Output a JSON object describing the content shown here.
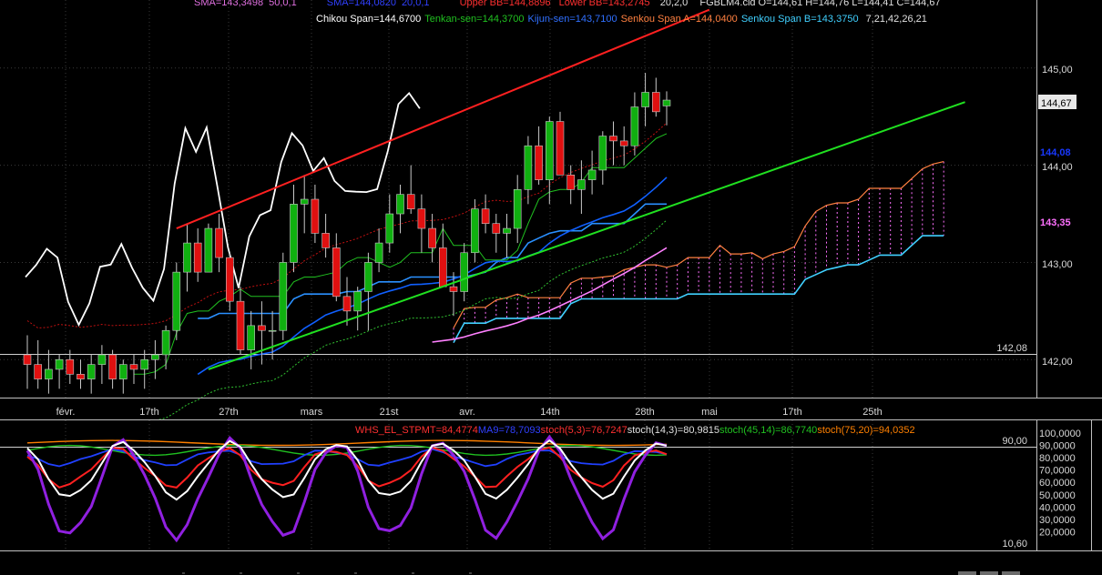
{
  "instrument": {
    "ohlc_label": "FGBLM4.cld O=144,61 H=144,76 L=144,41 C=144,67",
    "sma1_label": "SMA=143,3498",
    "sma1_params": "50,0,1",
    "sma2_label": "SMA=144,0820",
    "sma2_params": "20,0,1",
    "upper_bb_label": "Upper BB=144,8896",
    "lower_bb_label": "Lower BB=143,2745",
    "bb_params": "20,2,0"
  },
  "ichimoku": {
    "chikou": "Chikou Span=144,6700",
    "tenkan": "Tenkan-sen=144,3700",
    "kijun": "Kijun-sen=143,7100",
    "senkou_a": "Senkou Span A=144,0400",
    "senkou_b": "Senkou Span B=143,3750",
    "params": "7,21,42,26,21"
  },
  "price_axis": {
    "ticks": [
      "145,00",
      "144,00",
      "143,00",
      "142,00"
    ],
    "last_price": "144,67",
    "sma20_value": "144,08",
    "sma50_value": "143,35",
    "support_level": "142,08"
  },
  "indicator": {
    "whs": "WHS_EL_STPMT=84,4774",
    "ma9": "MA9=78,7093",
    "stoch1": "stoch(5,3)=76,7247",
    "stoch2": "stoch(14,3)=80,9815",
    "stoch3": "stoch(45,14)=86,7740",
    "stoch4": "stoch(75,20)=94,0352",
    "ticks": [
      "100,0000",
      "90,0000",
      "80,0000",
      "70,0000",
      "60,0000",
      "50,0000",
      "40,0000",
      "30,0000",
      "20,0000"
    ],
    "level_high": "90,00",
    "level_low": "10,60"
  },
  "x_axis_labels": [
    "févr.",
    "17th",
    "27th",
    "mars",
    "21st",
    "avr.",
    "14th",
    "28th",
    "mai",
    "17th",
    "25th"
  ],
  "colors": {
    "background": "#000000",
    "bull_candle": "#10b010",
    "bear_candle": "#e01010",
    "chikou": "#ffffff",
    "tenkan": "#20c020",
    "kijun": "#1060ff",
    "senkou_a": "#ff8040",
    "senkou_b": "#40d0ff",
    "sma50": "#ff80ff",
    "upper_trend": "#ff2020",
    "lower_trend": "#20e020",
    "whs": "#ff2020",
    "ma9": "#2040ff",
    "stoch_5_3": "#ffffff",
    "stoch_14_3": "#9020e0",
    "stoch_45_14": "#20c020",
    "stoch_75_20": "#ff8000"
  },
  "chart_data": {
    "type": "candlestick",
    "symbol": "FGBLM4",
    "ohlc_last": {
      "open": 144.61,
      "high": 144.76,
      "low": 144.41,
      "close": 144.67
    },
    "y_range": [
      141.6,
      145.7
    ],
    "candles": [
      [
        142.05,
        142.25,
        141.7,
        141.95
      ],
      [
        141.95,
        142.2,
        141.7,
        141.8
      ],
      [
        141.8,
        142.1,
        141.65,
        141.9
      ],
      [
        141.9,
        142.05,
        141.7,
        142.0
      ],
      [
        142.0,
        142.1,
        141.75,
        141.85
      ],
      [
        141.85,
        142.0,
        141.7,
        141.8
      ],
      [
        141.8,
        142.05,
        141.65,
        141.95
      ],
      [
        141.95,
        142.15,
        141.75,
        142.05
      ],
      [
        142.05,
        142.1,
        141.7,
        141.8
      ],
      [
        141.8,
        142.0,
        141.65,
        141.95
      ],
      [
        141.95,
        142.05,
        141.75,
        141.9
      ],
      [
        141.9,
        142.1,
        141.7,
        142.0
      ],
      [
        142.0,
        142.2,
        141.8,
        142.05
      ],
      [
        142.05,
        142.35,
        141.9,
        142.3
      ],
      [
        142.3,
        143.0,
        142.2,
        142.9
      ],
      [
        142.9,
        143.4,
        142.7,
        143.2
      ],
      [
        143.2,
        143.35,
        142.8,
        142.9
      ],
      [
        142.9,
        143.4,
        142.9,
        143.35
      ],
      [
        143.35,
        143.5,
        142.9,
        143.05
      ],
      [
        143.05,
        143.1,
        142.5,
        142.6
      ],
      [
        142.6,
        142.75,
        142.05,
        142.1
      ],
      [
        142.1,
        142.5,
        141.9,
        142.35
      ],
      [
        142.35,
        142.6,
        141.95,
        142.3
      ],
      [
        142.3,
        142.5,
        142.0,
        142.3
      ],
      [
        142.3,
        143.1,
        142.2,
        143.0
      ],
      [
        143.0,
        143.8,
        142.9,
        143.6
      ],
      [
        143.6,
        143.9,
        143.3,
        143.65
      ],
      [
        143.65,
        143.8,
        143.2,
        143.3
      ],
      [
        143.3,
        143.5,
        143.05,
        143.15
      ],
      [
        143.15,
        143.3,
        142.6,
        142.65
      ],
      [
        142.65,
        142.85,
        142.35,
        142.5
      ],
      [
        142.5,
        142.75,
        142.3,
        142.7
      ],
      [
        142.7,
        143.1,
        142.3,
        143.0
      ],
      [
        143.0,
        143.35,
        142.9,
        143.2
      ],
      [
        143.2,
        143.7,
        143.1,
        143.5
      ],
      [
        143.5,
        143.8,
        143.3,
        143.7
      ],
      [
        143.7,
        144.0,
        143.5,
        143.55
      ],
      [
        143.55,
        143.7,
        143.1,
        143.35
      ],
      [
        143.35,
        143.5,
        143.0,
        143.15
      ],
      [
        143.15,
        143.4,
        142.8,
        142.75
      ],
      [
        142.75,
        142.9,
        142.45,
        142.7
      ],
      [
        142.7,
        143.2,
        142.6,
        143.1
      ],
      [
        143.1,
        143.65,
        143.0,
        143.55
      ],
      [
        143.55,
        143.7,
        143.3,
        143.4
      ],
      [
        143.4,
        143.5,
        143.1,
        143.3
      ],
      [
        143.3,
        143.5,
        143.05,
        143.35
      ],
      [
        143.35,
        143.9,
        143.2,
        143.75
      ],
      [
        143.75,
        144.3,
        143.6,
        144.2
      ],
      [
        144.2,
        144.4,
        143.8,
        143.85
      ],
      [
        143.85,
        144.5,
        143.6,
        144.45
      ],
      [
        144.45,
        144.55,
        144.0,
        143.9
      ],
      [
        143.9,
        144.0,
        143.6,
        143.75
      ],
      [
        143.75,
        144.05,
        143.5,
        143.85
      ],
      [
        143.85,
        144.15,
        143.7,
        143.95
      ],
      [
        143.95,
        144.35,
        143.8,
        144.3
      ],
      [
        144.3,
        144.45,
        144.0,
        144.25
      ],
      [
        144.25,
        144.4,
        144.0,
        144.2
      ],
      [
        144.2,
        144.75,
        144.1,
        144.6
      ],
      [
        144.6,
        144.95,
        144.4,
        144.75
      ],
      [
        144.75,
        144.9,
        144.5,
        144.55
      ],
      [
        144.61,
        144.76,
        144.41,
        144.67
      ]
    ],
    "trendlines": [
      {
        "name": "upper",
        "from": [
          14,
          143.35
        ],
        "to": [
          64,
          145.6
        ]
      },
      {
        "name": "lower",
        "from": [
          17,
          141.9
        ],
        "to": [
          88,
          144.65
        ]
      }
    ],
    "horizontal_levels": [
      142.08
    ],
    "oscillator_range": [
      10,
      100
    ]
  }
}
